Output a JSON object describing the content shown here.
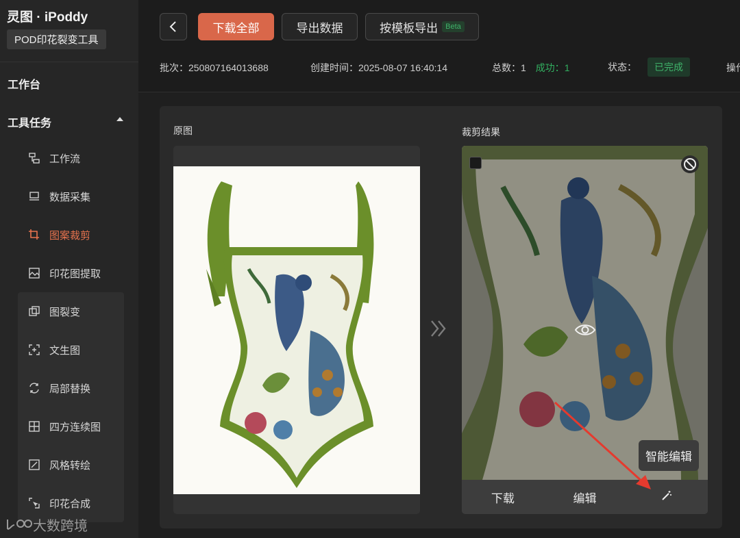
{
  "sidebar": {
    "brand": "灵图 · iPoddy",
    "subtitle": "POD印花裂变工具",
    "workbench": "工作台",
    "tools_header": "工具任务",
    "items": [
      {
        "label": "工作流",
        "icon": "workflow-icon"
      },
      {
        "label": "数据采集",
        "icon": "data-collect-icon"
      },
      {
        "label": "图案裁剪",
        "icon": "crop-icon",
        "active": true
      },
      {
        "label": "印花图提取",
        "icon": "extract-icon"
      },
      {
        "label": "图裂变",
        "icon": "fission-icon"
      },
      {
        "label": "文生图",
        "icon": "text-to-image-icon"
      },
      {
        "label": "局部替换",
        "icon": "replace-icon"
      },
      {
        "label": "四方连续图",
        "icon": "tile-icon"
      },
      {
        "label": "风格转绘",
        "icon": "style-icon"
      },
      {
        "label": "印花合成",
        "icon": "compose-icon"
      }
    ],
    "watermark": "大数跨境"
  },
  "toolbar": {
    "download_all": "下载全部",
    "export_data": "导出数据",
    "export_template": "按模板导出",
    "beta": "Beta"
  },
  "meta": {
    "batch_label": "批次：",
    "batch_value": "250807164013688",
    "created_label": "创建时间：",
    "created_value": "2025-08-07 16:40:14",
    "total_label": "总数：",
    "total_value": "1",
    "success_label": "成功：",
    "success_value": "1",
    "status_label": "状态：",
    "status_value": "已完成",
    "ops_label": "操作"
  },
  "main": {
    "original_label": "原图",
    "result_label": "裁剪结果",
    "actions": {
      "download": "下载",
      "edit": "编辑"
    },
    "tooltip": "智能编辑"
  },
  "colors": {
    "accent": "#d9674a",
    "success": "#32b060",
    "swimsuit_green": "#6b8f2a"
  }
}
